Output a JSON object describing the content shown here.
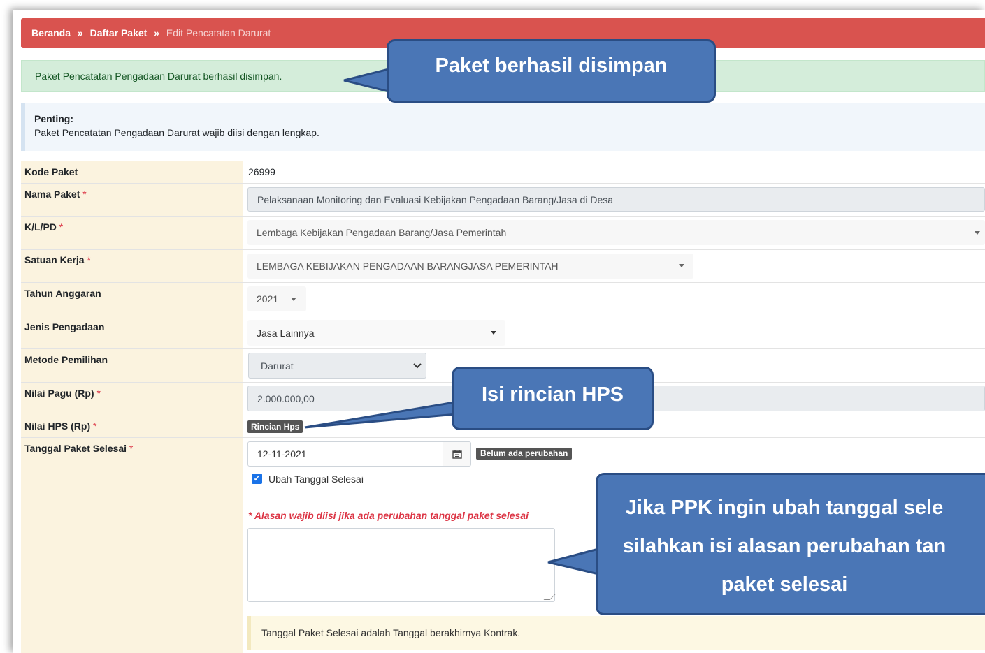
{
  "breadcrumb": {
    "home": "Beranda",
    "sep": "»",
    "list": "Daftar Paket",
    "current": "Edit Pencatatan Darurat"
  },
  "alert_success": "Paket Pencatatan Pengadaan Darurat berhasil disimpan.",
  "info": {
    "title": "Penting:",
    "text": "Paket Pencatatan Pengadaan Darurat wajib diisi dengan lengkap."
  },
  "form": {
    "kode_paket": {
      "label": "Kode Paket",
      "value": "26999"
    },
    "nama_paket": {
      "label": "Nama Paket",
      "value": "Pelaksanaan Monitoring dan Evaluasi Kebijakan Pengadaan Barang/Jasa di Desa"
    },
    "klpd": {
      "label": "K/L/PD",
      "value": "Lembaga Kebijakan Pengadaan Barang/Jasa Pemerintah"
    },
    "satuan_kerja": {
      "label": "Satuan Kerja",
      "value": "LEMBAGA KEBIJAKAN PENGADAAN BARANGJASA PEMERINTAH"
    },
    "tahun_anggaran": {
      "label": "Tahun Anggaran",
      "value": "2021"
    },
    "jenis_pengadaan": {
      "label": "Jenis Pengadaan",
      "value": "Jasa Lainnya"
    },
    "metode_pemilihan": {
      "label": "Metode Pemilihan",
      "value": "Darurat"
    },
    "nilai_pagu": {
      "label": "Nilai Pagu (Rp)",
      "value": "2.000.000,00"
    },
    "nilai_hps": {
      "label": "Nilai HPS (Rp)",
      "button": "Rincian Hps"
    },
    "tanggal_selesai": {
      "label": "Tanggal Paket Selesai",
      "value": "12-11-2021",
      "badge": "Belum ada perubahan",
      "checkbox_label": "Ubah Tanggal Selesai",
      "warning": "* Alasan wajib diisi jika ada perubahan tanggal paket selesai",
      "note": "Tanggal Paket Selesai adalah Tanggal berakhirnya Kontrak."
    },
    "required_mark": "*"
  },
  "callouts": {
    "saved": "Paket berhasil disimpan",
    "hps": "Isi rincian HPS",
    "reason_line1": "Jika PPK ingin ubah tanggal sele",
    "reason_line2": "silahkan isi alasan perubahan tan",
    "reason_line3": "paket selesai"
  },
  "icons": {
    "calendar": "calendar-icon",
    "dropdown": "caret-down-icon",
    "checkbox": "check-icon"
  },
  "colors": {
    "breadcrumb_bg": "#d9534f",
    "success_bg": "#d4edda",
    "label_bg": "#fbf3df",
    "callout_bg": "#4a76b6"
  }
}
